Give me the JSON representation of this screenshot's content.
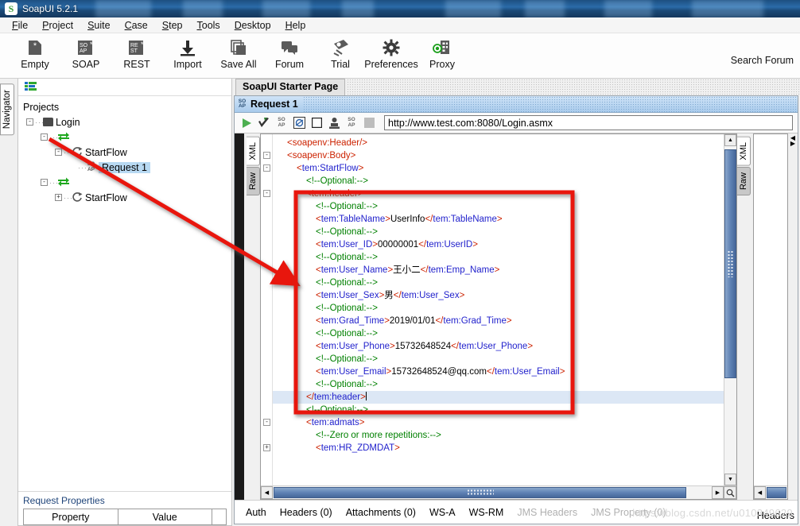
{
  "window": {
    "title": "SoapUI 5.2.1",
    "logo_icon": "soapui-logo-icon"
  },
  "menubar": {
    "items": [
      "File",
      "Project",
      "Suite",
      "Case",
      "Step",
      "Tools",
      "Desktop",
      "Help"
    ]
  },
  "toolbar": {
    "items": [
      {
        "label": "Empty",
        "icon": "empty-project-icon"
      },
      {
        "label": "SOAP",
        "icon": "soap-project-icon"
      },
      {
        "label": "REST",
        "icon": "rest-project-icon"
      },
      {
        "label": "Import",
        "icon": "import-icon"
      },
      {
        "label": "Save All",
        "icon": "save-all-icon"
      },
      {
        "label": "Forum",
        "icon": "forum-icon"
      },
      {
        "label": "Trial",
        "icon": "trial-icon"
      },
      {
        "label": "Preferences",
        "icon": "gear-icon"
      },
      {
        "label": "Proxy",
        "icon": "proxy-icon"
      }
    ],
    "search_forum": "Search Forum"
  },
  "navigator": {
    "tab_label": "Navigator",
    "toolbar_icon": "list-view-icon",
    "root_label": "Projects",
    "tree": [
      {
        "label": "Login",
        "icon": "folder-icon",
        "indent": 0,
        "toggle": "-"
      },
      {
        "label": "",
        "icon": "interface-arrows-icon",
        "indent": 1,
        "toggle": "-"
      },
      {
        "label": "StartFlow",
        "icon": "operation-loop-icon",
        "indent": 2,
        "toggle": "-"
      },
      {
        "label": "Request 1",
        "icon": "soap-request-icon",
        "indent": 3,
        "toggle": "",
        "selected": true
      },
      {
        "label": "",
        "icon": "interface-arrows-icon",
        "indent": 1,
        "toggle": "-"
      },
      {
        "label": "StartFlow",
        "icon": "operation-loop-icon",
        "indent": 2,
        "toggle": "+"
      }
    ],
    "properties": {
      "title": "Request Properties",
      "columns": [
        "Property",
        "Value"
      ]
    }
  },
  "desktop": {
    "starter_tab": "SoapUI Starter Page",
    "frame": {
      "title": "Request 1",
      "badge_icon": "soap-request-icon",
      "toolbar_icons": [
        "run-icon",
        "validate-icon",
        "soap-wss-icon",
        "create-mock-icon",
        "stop-icon",
        "outline-icon",
        "soap-endpoint-icon",
        "disabled-icon"
      ],
      "url": "http://www.test.com:8080/Login.asmx"
    },
    "request_editor": {
      "tabs": [
        {
          "label": "XML",
          "active": true
        },
        {
          "label": "Raw",
          "active": false
        }
      ],
      "lines": [
        {
          "indent": 1,
          "fold": "",
          "parts": [
            {
              "t": "tg",
              "v": "<soapenv:Header/>"
            }
          ]
        },
        {
          "indent": 1,
          "fold": "-",
          "parts": [
            {
              "t": "tg",
              "v": "<soapenv:Body>"
            }
          ]
        },
        {
          "indent": 2,
          "fold": "-",
          "parts": [
            {
              "t": "tg",
              "v": "<"
            },
            {
              "t": "tgb",
              "v": "tem:StartFlow"
            },
            {
              "t": "tg",
              "v": ">"
            }
          ]
        },
        {
          "indent": 3,
          "fold": "",
          "parts": [
            {
              "t": "cm",
              "v": "<!--Optional:-->"
            }
          ]
        },
        {
          "indent": 3,
          "fold": "-",
          "parts": [
            {
              "t": "tg",
              "v": "<tem:header>"
            }
          ]
        },
        {
          "indent": 4,
          "fold": "",
          "parts": [
            {
              "t": "cm",
              "v": "<!--Optional:-->"
            }
          ]
        },
        {
          "indent": 4,
          "fold": "",
          "parts": [
            {
              "t": "tg",
              "v": "<"
            },
            {
              "t": "tgb",
              "v": "tem:TableName"
            },
            {
              "t": "tg",
              "v": ">"
            },
            {
              "t": "tx",
              "v": "UserInfo"
            },
            {
              "t": "tg",
              "v": "</"
            },
            {
              "t": "tgb",
              "v": "tem:TableName"
            },
            {
              "t": "tg",
              "v": ">"
            }
          ]
        },
        {
          "indent": 4,
          "fold": "",
          "parts": [
            {
              "t": "cm",
              "v": "<!--Optional:-->"
            }
          ]
        },
        {
          "indent": 4,
          "fold": "",
          "parts": [
            {
              "t": "tg",
              "v": "<"
            },
            {
              "t": "tgb",
              "v": "tem:User_ID"
            },
            {
              "t": "tg",
              "v": ">"
            },
            {
              "t": "tx",
              "v": "00000001"
            },
            {
              "t": "tg",
              "v": "</"
            },
            {
              "t": "tgb",
              "v": "tem:UserID"
            },
            {
              "t": "tg",
              "v": ">"
            }
          ]
        },
        {
          "indent": 4,
          "fold": "",
          "parts": [
            {
              "t": "cm",
              "v": "<!--Optional:-->"
            }
          ]
        },
        {
          "indent": 4,
          "fold": "",
          "parts": [
            {
              "t": "tg",
              "v": "<"
            },
            {
              "t": "tgb",
              "v": "tem:User_Name"
            },
            {
              "t": "tg",
              "v": ">"
            },
            {
              "t": "tx",
              "v": "王小二"
            },
            {
              "t": "tg",
              "v": "</"
            },
            {
              "t": "tgb",
              "v": "tem:Emp_Name"
            },
            {
              "t": "tg",
              "v": ">"
            }
          ]
        },
        {
          "indent": 4,
          "fold": "",
          "parts": [
            {
              "t": "cm",
              "v": "<!--Optional:-->"
            }
          ]
        },
        {
          "indent": 4,
          "fold": "",
          "parts": [
            {
              "t": "tg",
              "v": "<"
            },
            {
              "t": "tgb",
              "v": "tem:User_Sex"
            },
            {
              "t": "tg",
              "v": ">"
            },
            {
              "t": "tx",
              "v": "男"
            },
            {
              "t": "tg",
              "v": "</"
            },
            {
              "t": "tgb",
              "v": "tem:User_Sex"
            },
            {
              "t": "tg",
              "v": ">"
            }
          ]
        },
        {
          "indent": 4,
          "fold": "",
          "parts": [
            {
              "t": "cm",
              "v": "<!--Optional:-->"
            }
          ]
        },
        {
          "indent": 4,
          "fold": "",
          "parts": [
            {
              "t": "tg",
              "v": "<"
            },
            {
              "t": "tgb",
              "v": "tem:Grad_Time"
            },
            {
              "t": "tg",
              "v": ">"
            },
            {
              "t": "tx",
              "v": "2019/01/01"
            },
            {
              "t": "tg",
              "v": "</"
            },
            {
              "t": "tgb",
              "v": "tem:Grad_Time"
            },
            {
              "t": "tg",
              "v": ">"
            }
          ]
        },
        {
          "indent": 4,
          "fold": "",
          "parts": [
            {
              "t": "cm",
              "v": "<!--Optional:-->"
            }
          ]
        },
        {
          "indent": 4,
          "fold": "",
          "parts": [
            {
              "t": "tg",
              "v": "<"
            },
            {
              "t": "tgb",
              "v": "tem:User_Phone"
            },
            {
              "t": "tg",
              "v": ">"
            },
            {
              "t": "tx",
              "v": "15732648524"
            },
            {
              "t": "tg",
              "v": "</"
            },
            {
              "t": "tgb",
              "v": "tem:User_Phone"
            },
            {
              "t": "tg",
              "v": ">"
            }
          ]
        },
        {
          "indent": 4,
          "fold": "",
          "parts": [
            {
              "t": "cm",
              "v": "<!--Optional:-->"
            }
          ]
        },
        {
          "indent": 4,
          "fold": "",
          "parts": [
            {
              "t": "tg",
              "v": "<"
            },
            {
              "t": "tgb",
              "v": "tem:User_Email"
            },
            {
              "t": "tg",
              "v": ">"
            },
            {
              "t": "tx",
              "v": "15732648524@qq.com"
            },
            {
              "t": "tg",
              "v": "</"
            },
            {
              "t": "tgb",
              "v": "tem:User_Email"
            },
            {
              "t": "tg",
              "v": ">"
            }
          ]
        },
        {
          "indent": 4,
          "fold": "",
          "parts": [
            {
              "t": "cm",
              "v": "<!--Optional:-->"
            }
          ]
        },
        {
          "indent": 3,
          "fold": "",
          "current": true,
          "parts": [
            {
              "t": "tg",
              "v": "</"
            },
            {
              "t": "tgb",
              "v": "tem:header"
            },
            {
              "t": "tg",
              "v": ">"
            }
          ]
        },
        {
          "indent": 3,
          "fold": "",
          "parts": [
            {
              "t": "cm",
              "v": "<!--Optional:-->"
            }
          ]
        },
        {
          "indent": 3,
          "fold": "-",
          "parts": [
            {
              "t": "tg",
              "v": "<"
            },
            {
              "t": "tgb",
              "v": "tem:admats"
            },
            {
              "t": "tg",
              "v": ">"
            }
          ]
        },
        {
          "indent": 4,
          "fold": "",
          "parts": [
            {
              "t": "cm",
              "v": "<!--Zero or more repetitions:-->"
            }
          ]
        },
        {
          "indent": 4,
          "fold": "+",
          "parts": [
            {
              "t": "tg",
              "v": "<"
            },
            {
              "t": "tgb",
              "v": "tem:HR_ZDMDAT"
            },
            {
              "t": "tg",
              "v": ">"
            }
          ]
        }
      ]
    },
    "response_editor": {
      "tabs": [
        {
          "label": "XML",
          "active": true
        },
        {
          "label": "Raw",
          "active": false
        }
      ]
    },
    "bottom_tabs": [
      {
        "label": "Auth",
        "dim": false
      },
      {
        "label": "Headers (0)",
        "dim": false
      },
      {
        "label": "Attachments (0)",
        "dim": false
      },
      {
        "label": "WS-A",
        "dim": false
      },
      {
        "label": "WS-RM",
        "dim": false
      },
      {
        "label": "JMS Headers",
        "dim": true
      },
      {
        "label": "JMS Property (0)",
        "dim": true
      }
    ],
    "bottom_right_tab": "Headers",
    "watermark": "https://blog.csdn.net/u010349629"
  },
  "annotations": {
    "arrow_color": "#e8120c"
  }
}
